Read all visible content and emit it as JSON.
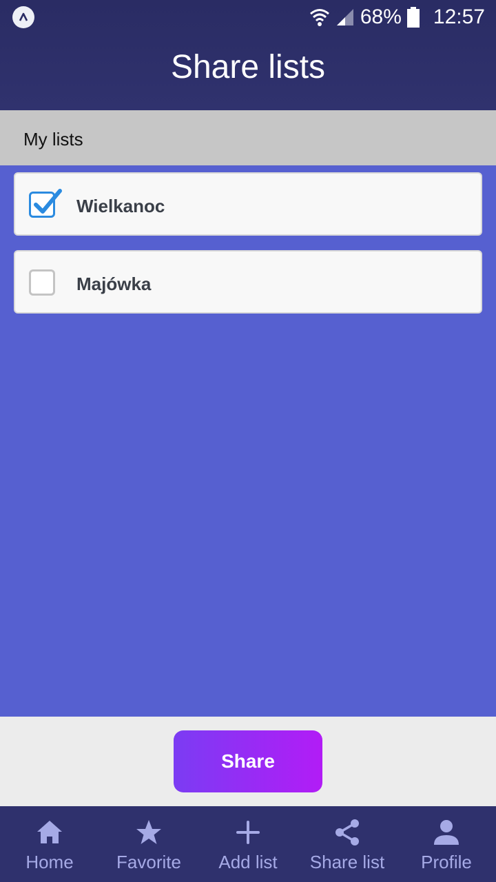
{
  "status_bar": {
    "battery_percent": "68%",
    "time": "12:57",
    "icons": [
      "app-badge-icon",
      "wifi-icon",
      "signal-icon",
      "battery-icon"
    ]
  },
  "header": {
    "title": "Share lists"
  },
  "section": {
    "title": "My lists"
  },
  "lists": [
    {
      "label": "Wielkanoc",
      "checked": true
    },
    {
      "label": "Majówka",
      "checked": false
    }
  ],
  "actions": {
    "share_label": "Share"
  },
  "bottom_nav": [
    {
      "label": "Home",
      "icon": "home-icon"
    },
    {
      "label": "Favorite",
      "icon": "star-icon"
    },
    {
      "label": "Add list",
      "icon": "plus-icon"
    },
    {
      "label": "Share list",
      "icon": "share-icon"
    },
    {
      "label": "Profile",
      "icon": "profile-icon"
    }
  ],
  "colors": {
    "header": "#2f316d",
    "content_bg": "#5660d0",
    "section_bar": "#c6c6c6",
    "checkbox_checked": "#2b8be0",
    "share_gradient_start": "#7b3cf3",
    "share_gradient_end": "#b21cf6",
    "nav_text": "#a6aae6"
  }
}
